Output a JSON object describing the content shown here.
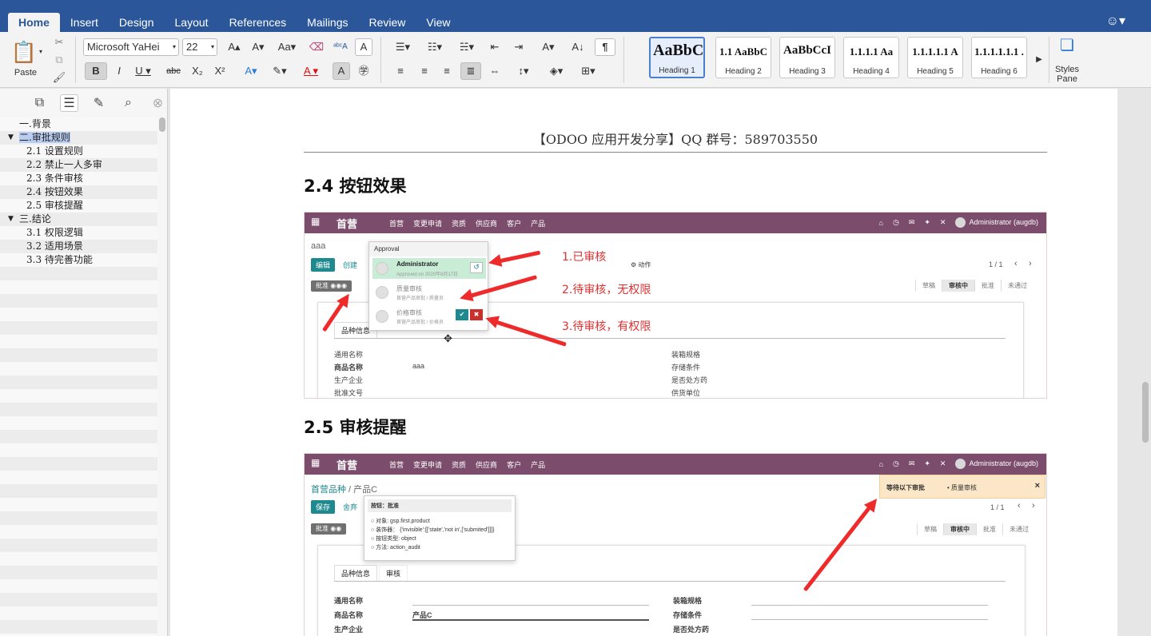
{
  "ribbon": {
    "tabs": [
      "Home",
      "Insert",
      "Design",
      "Layout",
      "References",
      "Mailings",
      "Review",
      "View"
    ],
    "paste_label": "Paste",
    "font_name": "Microsoft YaHei",
    "font_size": "22",
    "styles": [
      {
        "preview": "AaBbC",
        "name": "Heading 1"
      },
      {
        "preview": "1.1 AaBbC",
        "name": "Heading 2"
      },
      {
        "preview": "AaBbCcI",
        "name": "Heading 3"
      },
      {
        "preview": "1.1.1.1 Aa",
        "name": "Heading 4"
      },
      {
        "preview": "1.1.1.1.1 A",
        "name": "Heading 5"
      },
      {
        "preview": "1.1.1.1.1.1 .",
        "name": "Heading 6"
      }
    ],
    "styles_pane_label": "Styles Pane"
  },
  "nav": {
    "items": [
      {
        "text": "一.背景",
        "level": 1,
        "expand": ""
      },
      {
        "text": "二.审批规则",
        "level": 1,
        "expand": "▼",
        "selected": true
      },
      {
        "text": "2.1 设置规则",
        "level": 2
      },
      {
        "text": "2.2 禁止一人多审",
        "level": 2
      },
      {
        "text": "2.3 条件审核",
        "level": 2
      },
      {
        "text": "2.4 按钮效果",
        "level": 2
      },
      {
        "text": "2.5 审核提醒",
        "level": 2
      },
      {
        "text": "三.结论",
        "level": 1,
        "expand": "▼"
      },
      {
        "text": "3.1 权限逻辑",
        "level": 2
      },
      {
        "text": "3.2 适用场景",
        "level": 2
      },
      {
        "text": "3.3 待完善功能",
        "level": 2
      }
    ]
  },
  "doc": {
    "header": "【ODOO 应用开发分享】QQ 群号：589703550",
    "h_24": "2.4  按钮效果",
    "h_25": "2.5  审核提醒"
  },
  "shot1": {
    "brand": "首营",
    "menu": [
      "首营",
      "变更申请",
      "资质",
      "供应商",
      "客户",
      "产品"
    ],
    "user": "Administrator (augdb)",
    "record_name": "aaa",
    "edit": "编辑",
    "create": "创建",
    "action": "⚙ 动作",
    "pager": "1 / 1",
    "approve_badge": "批准",
    "states": [
      "草稿",
      "审核中",
      "批准",
      "未通过"
    ],
    "tab_info": "品种信息",
    "fields_left": [
      "通用名称",
      "商品名称",
      "生产企业",
      "批准文号"
    ],
    "product_value": "aaa",
    "fields_right": [
      "装箱规格",
      "存储条件",
      "是否处方药",
      "供货单位"
    ],
    "popup_title": "Approval",
    "approvers": [
      {
        "name": "Administrator",
        "detail": "Approved on 2020年8月17日"
      },
      {
        "name": "质量审核",
        "detail": "首营产品审批 / 质量员"
      },
      {
        "name": "价格审核",
        "detail": "首营产品审批 / 价格员"
      }
    ],
    "notes": [
      "1.已审核",
      "2.待审核，无权限",
      "3.待审核，有权限"
    ]
  },
  "shot2": {
    "brand": "首营",
    "menu": [
      "首营",
      "变更申请",
      "资质",
      "供应商",
      "客户",
      "产品"
    ],
    "user": "Administrator (augdb)",
    "breadcrumb_root": "首营品种",
    "breadcrumb_sep": " / ",
    "breadcrumb_leaf": "产品C",
    "save": "保存",
    "discard": "舍弃",
    "pager": "1 / 1",
    "approve_badge": "批准",
    "states": [
      "草稿",
      "审核中",
      "批准",
      "未通过"
    ],
    "tabs": [
      "品种信息",
      "审核"
    ],
    "fields_left": [
      "通用名称",
      "商品名称",
      "生产企业"
    ],
    "product_value": "产品C",
    "fields_right": [
      "装箱规格",
      "存储条件",
      "是否处方药"
    ],
    "notify_title": "等待以下审批",
    "notify_item": "•  质量审核",
    "notify_close": "×",
    "tooltip_title": "按钮：批准",
    "tooltip_lines": [
      "○  对象: gsp.first.product",
      "○  装饰器： {'invisible':[['state','not in',['submited']]]}",
      "○  按钮类型:   object",
      "○  方法:   action_audit"
    ]
  }
}
